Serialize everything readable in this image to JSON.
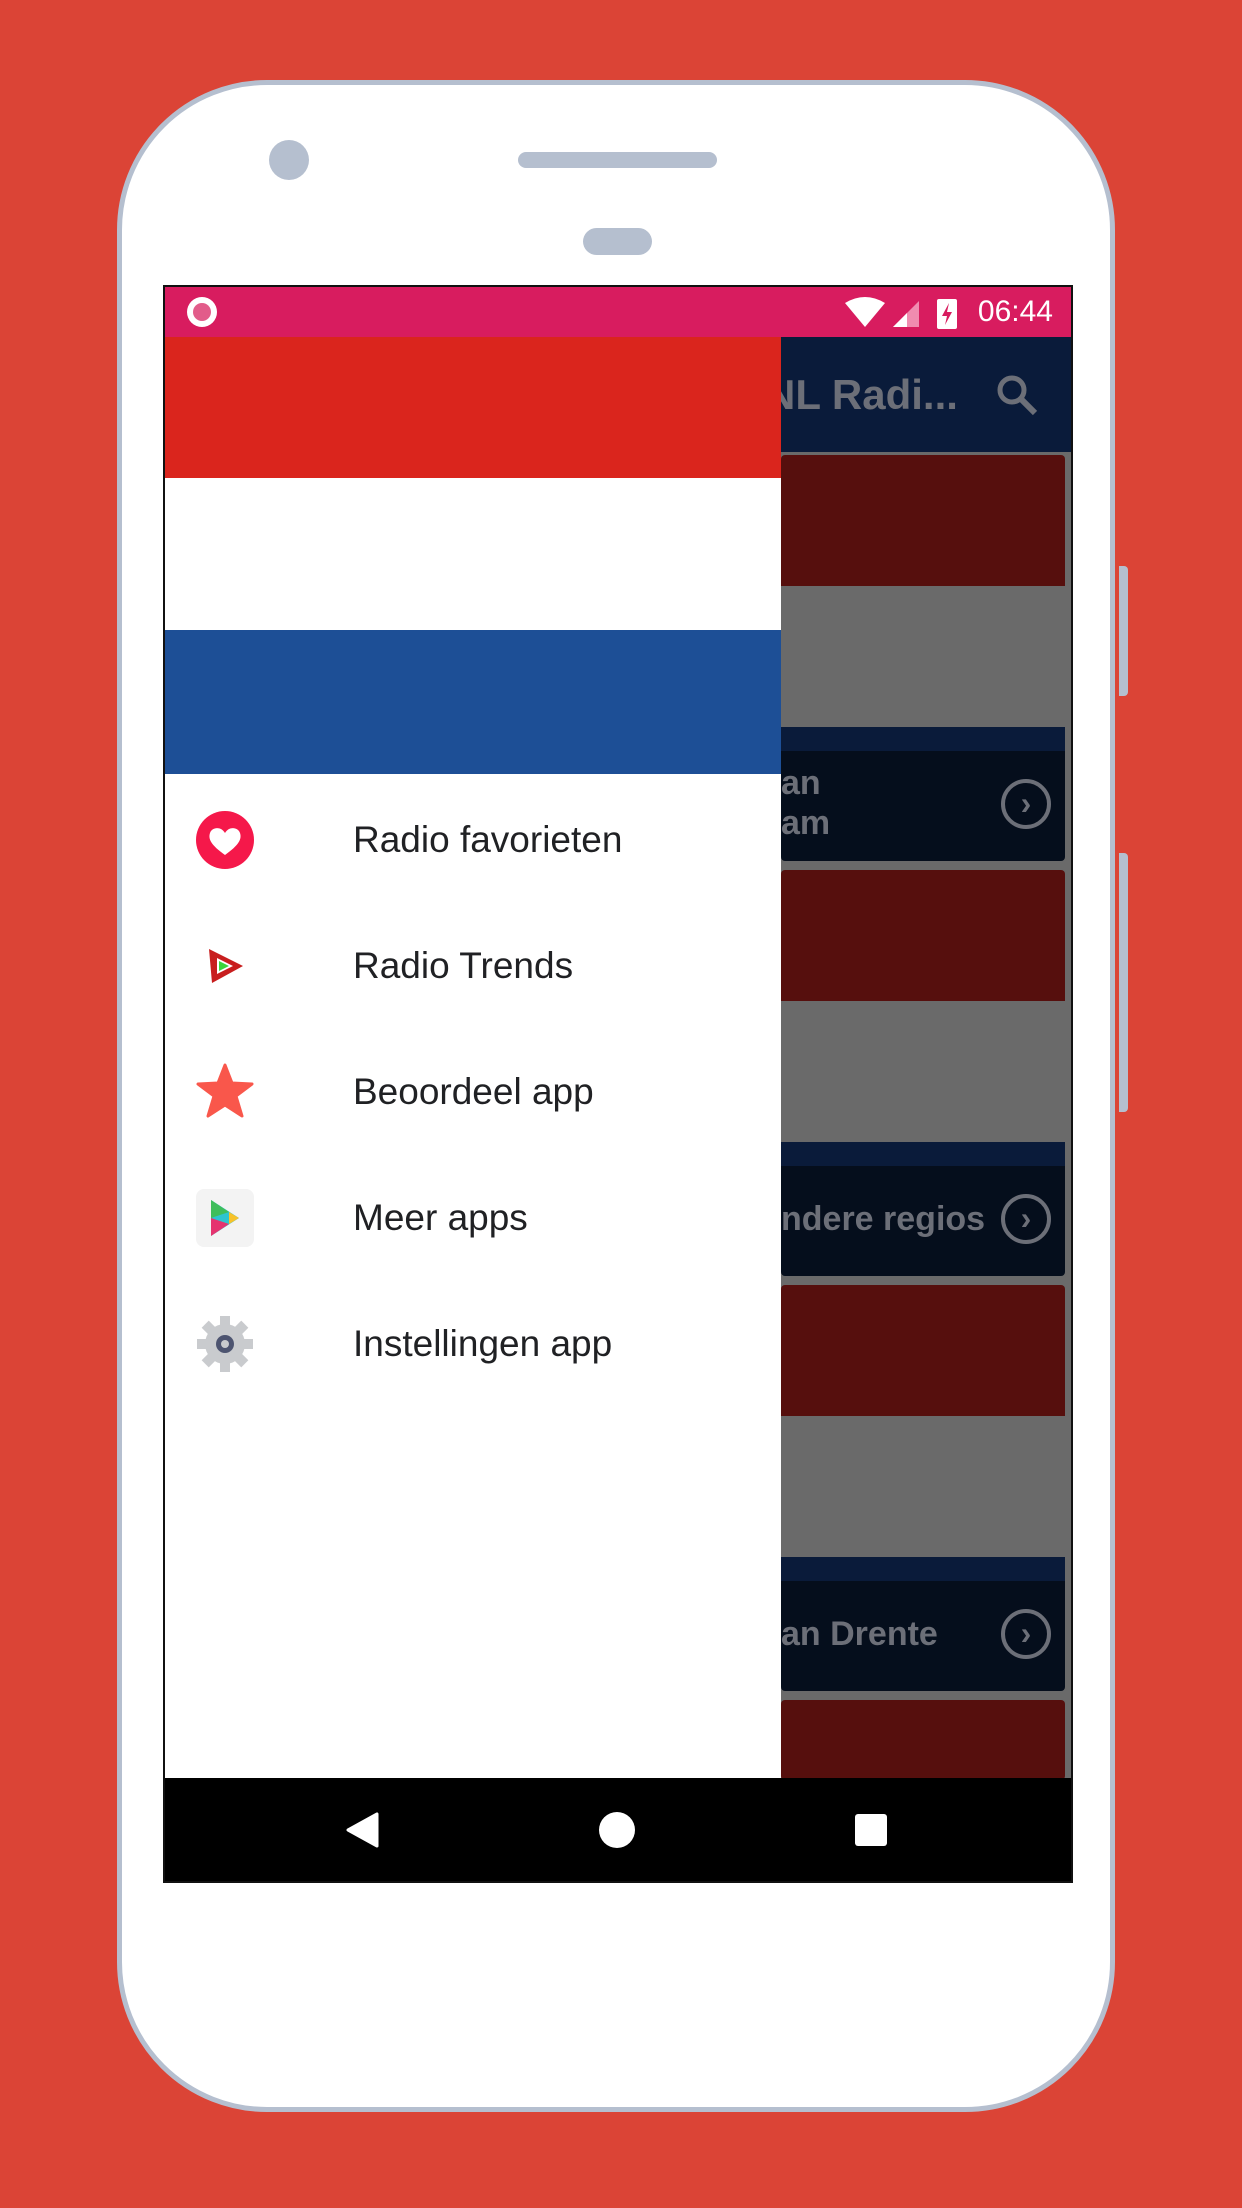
{
  "status_bar": {
    "time": "06:44",
    "icons": [
      "record-icon",
      "wifi-icon",
      "signal-icon",
      "battery-charging-icon"
    ],
    "color": "#D81C5F"
  },
  "app_bar": {
    "title": "NL Radi...",
    "search_icon": "search-icon"
  },
  "background_list": [
    {
      "label_line1": "an",
      "label_line2": "am"
    },
    {
      "label_line1": "ndere regios",
      "label_line2": ""
    },
    {
      "label_line1": "an Drente",
      "label_line2": ""
    }
  ],
  "drawer": {
    "flag_colors": [
      "#DA251D",
      "#FFFFFF",
      "#1D4F96"
    ],
    "items": [
      {
        "label": "Radio favorieten",
        "icon": "heart-icon"
      },
      {
        "label": "Radio Trends",
        "icon": "trends-play-icon"
      },
      {
        "label": "Beoordeel app",
        "icon": "star-icon"
      },
      {
        "label": "Meer apps",
        "icon": "play-store-icon"
      },
      {
        "label": "Instellingen app",
        "icon": "gear-icon"
      }
    ]
  },
  "nav_bar": {
    "buttons": [
      "back",
      "home",
      "recents"
    ]
  },
  "colors": {
    "page_background": "#DB4436",
    "app_bar": "#0A1B3A"
  }
}
